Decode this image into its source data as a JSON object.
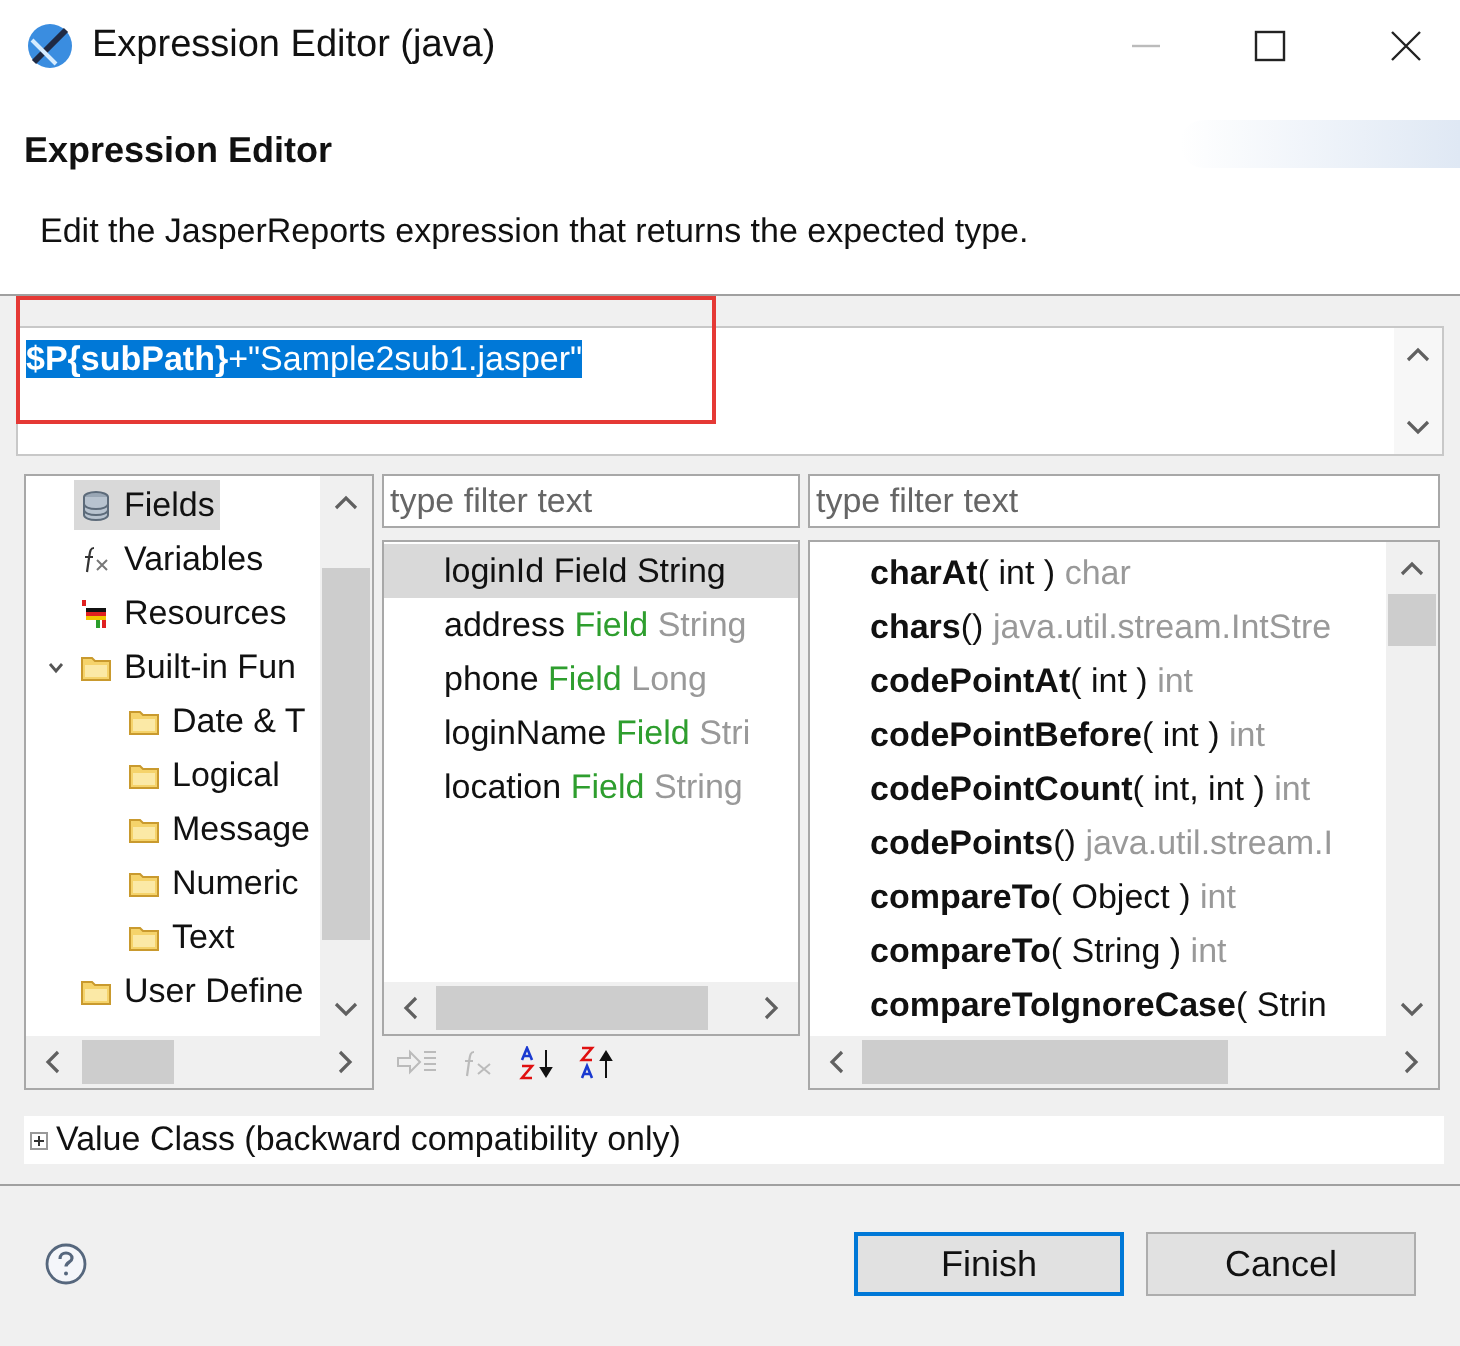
{
  "window": {
    "title": "Expression Editor (java)"
  },
  "header": {
    "title": "Expression Editor",
    "description": "Edit the JasperReports expression that returns the expected type."
  },
  "expression": {
    "text": "**$P{subPath}**+\"Sample2sub1.jasper\"",
    "selected": true
  },
  "tree": [
    {
      "label": "Fields",
      "kind": "database",
      "selected": true
    },
    {
      "label": "Variables",
      "kind": "function",
      "selected": false
    },
    {
      "label": "Resources",
      "kind": "resource",
      "selected": false
    },
    {
      "label": "Built-in Fun",
      "kind": "folder",
      "selected": false,
      "expanded": true,
      "children": [
        {
          "label": "Date & T",
          "kind": "folder",
          "selected": false
        },
        {
          "label": "Logical",
          "kind": "folder",
          "selected": false
        },
        {
          "label": "Message",
          "kind": "folder",
          "selected": false
        },
        {
          "label": "Numeric",
          "kind": "folder",
          "selected": false
        },
        {
          "label": "Text",
          "kind": "folder",
          "selected": false
        }
      ]
    },
    {
      "label": "User Define",
      "kind": "folder",
      "selected": false
    }
  ],
  "fields_filter": {
    "placeholder": "type filter text"
  },
  "fields": [
    {
      "name": "loginId",
      "kind": "Field",
      "type": "String",
      "selected": true
    },
    {
      "name": "address",
      "kind": "Field",
      "type": "String",
      "selected": false
    },
    {
      "name": "phone",
      "kind": "Field",
      "type": "Long",
      "selected": false
    },
    {
      "name": "loginName",
      "kind": "Field",
      "type": "Stri",
      "selected": false
    },
    {
      "name": "location",
      "kind": "Field",
      "type": "String",
      "selected": false
    }
  ],
  "methods_filter": {
    "placeholder": "type filter text"
  },
  "methods": [
    {
      "name": "charAt",
      "params": "( int )",
      "returns": "char"
    },
    {
      "name": "chars",
      "params": "()",
      "returns": "java.util.stream.IntStre"
    },
    {
      "name": "codePointAt",
      "params": "( int )",
      "returns": "int"
    },
    {
      "name": "codePointBefore",
      "params": "( int )",
      "returns": "int"
    },
    {
      "name": "codePointCount",
      "params": "( int, int )",
      "returns": "int"
    },
    {
      "name": "codePoints",
      "params": "()",
      "returns": "java.util.stream.I"
    },
    {
      "name": "compareTo",
      "params": "( Object )",
      "returns": "int"
    },
    {
      "name": "compareTo",
      "params": "( String )",
      "returns": "int"
    },
    {
      "name": "compareToIgnoreCase",
      "params": "( Strin"
    }
  ],
  "value_class": {
    "label": "Value Class (backward compatibility only)",
    "expanded": false
  },
  "buttons": [
    {
      "label": "Finish",
      "default": true
    },
    {
      "label": "Cancel",
      "default": false
    }
  ]
}
